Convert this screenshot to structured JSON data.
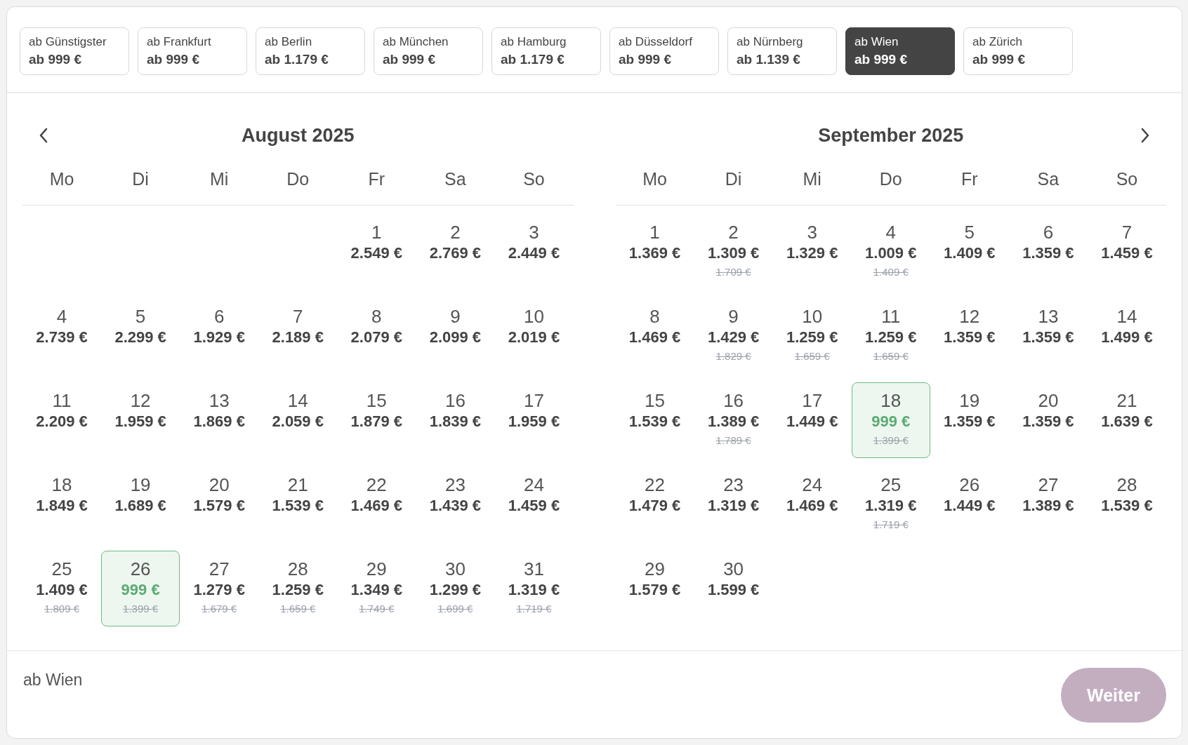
{
  "origins": [
    {
      "label": "ab Günstigster",
      "price": "ab 999 €",
      "selected": false
    },
    {
      "label": "ab Frankfurt",
      "price": "ab 999 €",
      "selected": false
    },
    {
      "label": "ab Berlin",
      "price": "ab 1.179 €",
      "selected": false
    },
    {
      "label": "ab München",
      "price": "ab 999 €",
      "selected": false
    },
    {
      "label": "ab Hamburg",
      "price": "ab 1.179 €",
      "selected": false
    },
    {
      "label": "ab Düsseldorf",
      "price": "ab 999 €",
      "selected": false
    },
    {
      "label": "ab Nürnberg",
      "price": "ab 1.139 €",
      "selected": false
    },
    {
      "label": "ab Wien",
      "price": "ab 999 €",
      "selected": true
    },
    {
      "label": "ab Zürich",
      "price": "ab 999 €",
      "selected": false
    }
  ],
  "months": [
    {
      "title": "August 2025",
      "weekdays": [
        "Mo",
        "Di",
        "Mi",
        "Do",
        "Fr",
        "Sa",
        "So"
      ],
      "weeks": [
        {
          "days": [
            {
              "day": "1",
              "price": "2.549 €",
              "selected": false
            },
            {
              "day": "2",
              "price": "2.769 €",
              "selected": false
            },
            {
              "day": "3",
              "price": "2.449 €",
              "selected": false
            }
          ]
        },
        {
          "days": [
            {
              "day": "4",
              "price": "2.739 €",
              "selected": false
            },
            {
              "day": "5",
              "price": "2.299 €",
              "selected": false
            },
            {
              "day": "6",
              "price": "1.929 €",
              "selected": false
            },
            {
              "day": "7",
              "price": "2.189 €",
              "selected": false
            },
            {
              "day": "8",
              "price": "2.079 €",
              "selected": false
            },
            {
              "day": "9",
              "price": "2.099 €",
              "selected": false
            },
            {
              "day": "10",
              "price": "2.019 €",
              "selected": false
            }
          ]
        },
        {
          "days": [
            {
              "day": "11",
              "price": "2.209 €",
              "selected": false
            },
            {
              "day": "12",
              "price": "1.959 €",
              "selected": false
            },
            {
              "day": "13",
              "price": "1.869 €",
              "selected": false
            },
            {
              "day": "14",
              "price": "2.059 €",
              "selected": false
            },
            {
              "day": "15",
              "price": "1.879 €",
              "selected": false
            },
            {
              "day": "16",
              "price": "1.839 €",
              "selected": false
            },
            {
              "day": "17",
              "price": "1.959 €",
              "selected": false
            }
          ]
        },
        {
          "days": [
            {
              "day": "18",
              "price": "1.849 €",
              "selected": false
            },
            {
              "day": "19",
              "price": "1.689 €",
              "selected": false
            },
            {
              "day": "20",
              "price": "1.579 €",
              "selected": false
            },
            {
              "day": "21",
              "price": "1.539 €",
              "selected": false
            },
            {
              "day": "22",
              "price": "1.469 €",
              "selected": false
            },
            {
              "day": "23",
              "price": "1.439 €",
              "selected": false
            },
            {
              "day": "24",
              "price": "1.459 €",
              "selected": false
            }
          ]
        },
        {
          "days": [
            {
              "day": "25",
              "price": "1.409 €",
              "old_price": "1.809 €",
              "selected": false
            },
            {
              "day": "26",
              "price": "999 €",
              "old_price": "1.399 €",
              "selected": true
            },
            {
              "day": "27",
              "price": "1.279 €",
              "old_price": "1.679 €",
              "selected": false
            },
            {
              "day": "28",
              "price": "1.259 €",
              "old_price": "1.659 €",
              "selected": false
            },
            {
              "day": "29",
              "price": "1.349 €",
              "old_price": "1.749 €",
              "selected": false
            },
            {
              "day": "30",
              "price": "1.299 €",
              "old_price": "1.699 €",
              "selected": false
            },
            {
              "day": "31",
              "price": "1.319 €",
              "old_price": "1.719 €",
              "selected": false
            }
          ]
        }
      ]
    },
    {
      "title": "September 2025",
      "weekdays": [
        "Mo",
        "Di",
        "Mi",
        "Do",
        "Fr",
        "Sa",
        "So"
      ],
      "weeks": [
        {
          "days": [
            {
              "day": "1",
              "price": "1.369 €",
              "selected": false
            },
            {
              "day": "2",
              "price": "1.309 €",
              "old_price": "1.709 €",
              "selected": false
            },
            {
              "day": "3",
              "price": "1.329 €",
              "selected": false
            },
            {
              "day": "4",
              "price": "1.009 €",
              "old_price": "1.409 €",
              "selected": false
            },
            {
              "day": "5",
              "price": "1.409 €",
              "selected": false
            },
            {
              "day": "6",
              "price": "1.359 €",
              "selected": false
            },
            {
              "day": "7",
              "price": "1.459 €",
              "selected": false
            }
          ]
        },
        {
          "days": [
            {
              "day": "8",
              "price": "1.469 €",
              "selected": false
            },
            {
              "day": "9",
              "price": "1.429 €",
              "old_price": "1.829 €",
              "selected": false
            },
            {
              "day": "10",
              "price": "1.259 €",
              "old_price": "1.659 €",
              "selected": false
            },
            {
              "day": "11",
              "price": "1.259 €",
              "old_price": "1.659 €",
              "selected": false
            },
            {
              "day": "12",
              "price": "1.359 €",
              "selected": false
            },
            {
              "day": "13",
              "price": "1.359 €",
              "selected": false
            },
            {
              "day": "14",
              "price": "1.499 €",
              "selected": false
            }
          ]
        },
        {
          "days": [
            {
              "day": "15",
              "price": "1.539 €",
              "selected": false
            },
            {
              "day": "16",
              "price": "1.389 €",
              "old_price": "1.789 €",
              "selected": false
            },
            {
              "day": "17",
              "price": "1.449 €",
              "selected": false
            },
            {
              "day": "18",
              "price": "999 €",
              "old_price": "1.399 €",
              "selected": true
            },
            {
              "day": "19",
              "price": "1.359 €",
              "selected": false
            },
            {
              "day": "20",
              "price": "1.359 €",
              "selected": false
            },
            {
              "day": "21",
              "price": "1.639 €",
              "selected": false
            }
          ]
        },
        {
          "days": [
            {
              "day": "22",
              "price": "1.479 €",
              "selected": false
            },
            {
              "day": "23",
              "price": "1.319 €",
              "selected": false
            },
            {
              "day": "24",
              "price": "1.469 €",
              "selected": false
            },
            {
              "day": "25",
              "price": "1.319 €",
              "old_price": "1.719 €",
              "selected": false
            },
            {
              "day": "26",
              "price": "1.449 €",
              "selected": false
            },
            {
              "day": "27",
              "price": "1.389 €",
              "selected": false
            },
            {
              "day": "28",
              "price": "1.539 €",
              "selected": false
            }
          ]
        },
        {
          "days": [
            {
              "day": "29",
              "price": "1.579 €",
              "selected": false
            },
            {
              "day": "30",
              "price": "1.599 €",
              "selected": false
            }
          ]
        }
      ]
    }
  ],
  "footer": {
    "origin": "ab Wien",
    "button": {
      "label": "Weiter",
      "disabled": true
    }
  }
}
